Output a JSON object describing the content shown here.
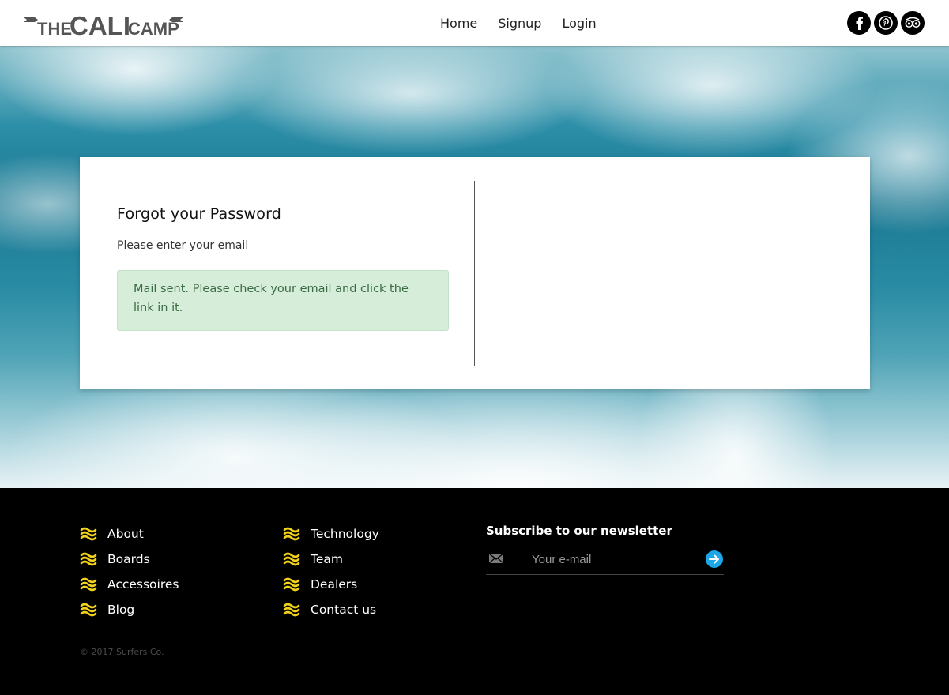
{
  "header": {
    "logo_text": {
      "the": "THE",
      "cali": "CALI",
      "camp": "CAMP"
    },
    "nav": [
      {
        "label": "Home"
      },
      {
        "label": "Signup"
      },
      {
        "label": "Login"
      }
    ],
    "social": [
      {
        "icon": "facebook-icon"
      },
      {
        "icon": "pinterest-icon"
      },
      {
        "icon": "tripadvisor-icon"
      }
    ]
  },
  "card": {
    "title": "Forgot your Password",
    "subtitle": "Please enter your email",
    "alert": "Mail sent. Please check your email and click the link in it."
  },
  "footer": {
    "col1": [
      {
        "label": "About"
      },
      {
        "label": "Boards"
      },
      {
        "label": "Accessoires"
      },
      {
        "label": "Blog"
      }
    ],
    "col2": [
      {
        "label": "Technology"
      },
      {
        "label": "Team"
      },
      {
        "label": "Dealers"
      },
      {
        "label": "Contact us"
      }
    ],
    "newsletter": {
      "title": "Subscribe to our newsletter",
      "placeholder": "Your e-mail"
    },
    "copyright": "© 2017 Surfers Co."
  },
  "colors": {
    "accent_yellow": "#f2d21a",
    "submit_blue": "#1ba7e8",
    "alert_bg": "#d6edd9",
    "alert_text": "#3a6b43"
  }
}
